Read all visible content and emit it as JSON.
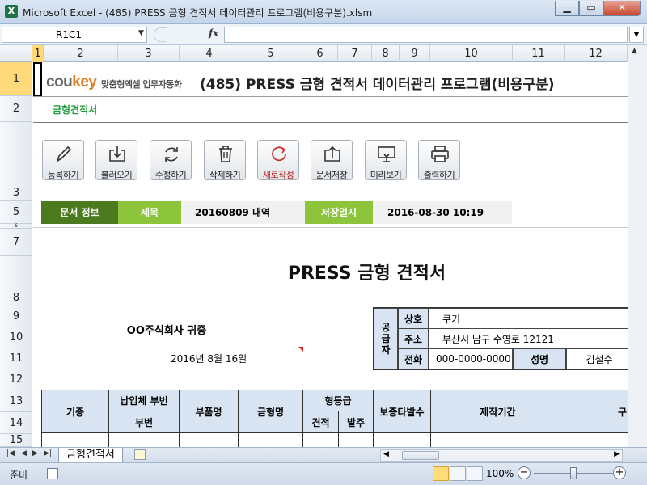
{
  "window": {
    "title": "Microsoft Excel - (485) PRESS 금형 견적서 데이터관리 프로그램(비용구분).xlsm",
    "app_icon": "X"
  },
  "formula_bar": {
    "name_box": "R1C1",
    "fx": "fx",
    "value": ""
  },
  "columns": [
    "1",
    "2",
    "3",
    "4",
    "5",
    "6",
    "7",
    "8",
    "9",
    "10",
    "11",
    "12"
  ],
  "rows": [
    "1",
    "2",
    "3",
    "5",
    "6",
    "7",
    "8",
    "9",
    "10",
    "11",
    "12",
    "13",
    "14",
    "15"
  ],
  "sheet": {
    "logo_main": "cou",
    "logo_key": "key",
    "logo_tag": "맞춤형엑셀 업무자동화",
    "header_title": "(485) PRESS 금형 견적서 데이터관리 프로그램(비용구분)",
    "subtitle": "금형견적서",
    "toolbar": [
      {
        "label": "등록하기",
        "icon": "pencil-icon"
      },
      {
        "label": "불러오기",
        "icon": "download-icon"
      },
      {
        "label": "수정하기",
        "icon": "refresh-icon"
      },
      {
        "label": "삭제하기",
        "icon": "trash-icon"
      },
      {
        "label": "새로작성",
        "icon": "new-doc-icon"
      },
      {
        "label": "문서저장",
        "icon": "upload-icon"
      },
      {
        "label": "미리보기",
        "icon": "monitor-icon"
      },
      {
        "label": "출력하기",
        "icon": "printer-icon"
      }
    ],
    "info": {
      "label": "문서 정보",
      "subject_label": "제목",
      "subject_value": "20160809 내역",
      "saved_label": "저장일시",
      "saved_value": "2016-08-30 10:19"
    },
    "doc_title": "PRESS 금형 견적서",
    "recipient": "OO주식회사 귀중",
    "date": "2016년 8월 16일",
    "supplier": {
      "section": [
        "공",
        "급",
        "자"
      ],
      "company_label": "상호",
      "company_value": "쿠키",
      "address_label": "주소",
      "address_value": "부산시 남구 수영로 12121",
      "phone_label": "전화",
      "phone_value": "000-0000-0000",
      "name_label": "성명",
      "name_value": "김철수"
    },
    "table_headers": {
      "model": "기종",
      "supplier_part": "납입체 부번",
      "part_no": "부번",
      "part_name": "부품명",
      "die_name": "금형명",
      "die_grade": "형등급",
      "quote": "견적",
      "order": "발주",
      "guarantee": "보증타발수",
      "period": "제작기간",
      "more": "구"
    }
  },
  "tabs": {
    "sheet_name": "금형견적서"
  },
  "status": {
    "ready": "준비",
    "zoom": "100%",
    "zoom_fraction": 0.5
  },
  "colors": {
    "accent_green": "#4b7a1f",
    "light_green": "#8cc43c",
    "header_blue": "#d8e4f2",
    "subtitle_green": "#1f9d3a"
  }
}
